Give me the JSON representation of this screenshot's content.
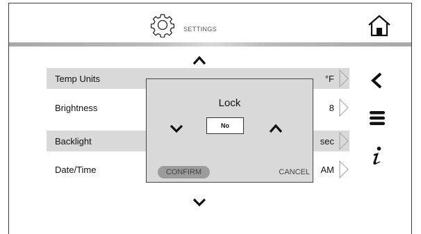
{
  "header": {
    "title": "SETTINGS",
    "gear_icon": "gear-icon",
    "home_icon": "home-icon"
  },
  "rows": [
    {
      "label": "Temp Units",
      "value": "°F",
      "shaded": true
    },
    {
      "label": "Brightness",
      "value": "8",
      "shaded": false
    },
    {
      "label": "Backlight",
      "value": "sec",
      "shaded": true
    },
    {
      "label": "Date/Time",
      "value": "AM",
      "shaded": false
    }
  ],
  "popup": {
    "title": "Lock",
    "value": "No",
    "confirm_label": "CONFIRM",
    "cancel_label": "CANCEL"
  },
  "sidebar": {
    "back_icon": "chevron-left-icon",
    "menu_icon": "menu-icon",
    "info_icon": "info-icon"
  },
  "colors": {
    "shade": "#d9d9d9",
    "frame": "#3a3a3a",
    "confirm_bg": "#9c9c9c"
  }
}
